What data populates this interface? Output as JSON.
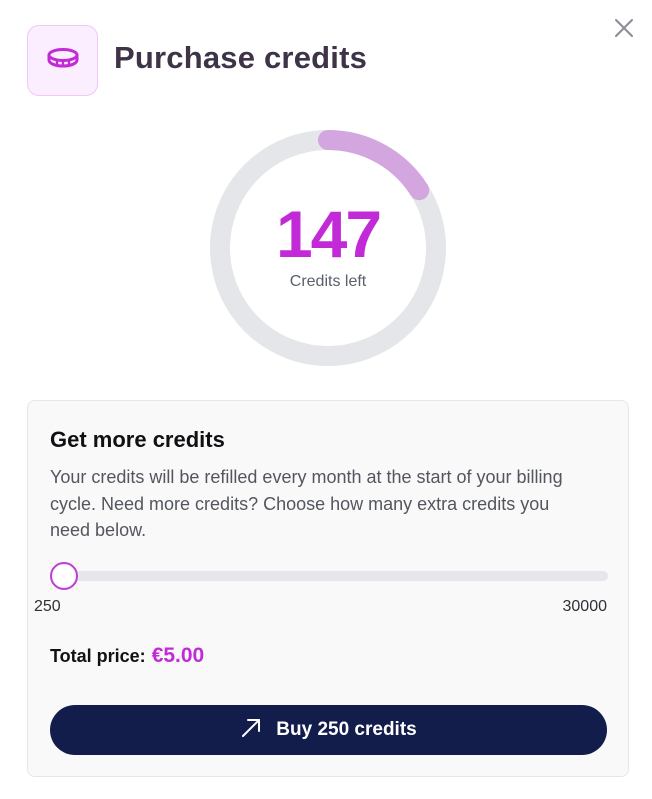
{
  "header": {
    "title": "Purchase credits",
    "icon": "coin-icon",
    "close_icon": "close-icon"
  },
  "credits": {
    "value": "147",
    "label": "Credits left",
    "remaining_fraction": 0.16
  },
  "card": {
    "title": "Get more credits",
    "description": "Your credits will be refilled every month at the start of your billing cycle. Need more credits? Choose how many extra credits you need below.",
    "slider": {
      "min_label": "250",
      "max_label": "30000",
      "min": 250,
      "max": 30000,
      "value": 250
    },
    "total_label": "Total price:",
    "total_price": "€5.00",
    "buy_button": {
      "icon": "arrow-up-right-icon",
      "label": "Buy 250 credits"
    }
  },
  "colors": {
    "accent": "#c22ad8",
    "gauge_fill": "#d3a6df",
    "gauge_track": "#e5e6ea",
    "button_bg": "#131d4b",
    "title_text": "#3f3447"
  }
}
